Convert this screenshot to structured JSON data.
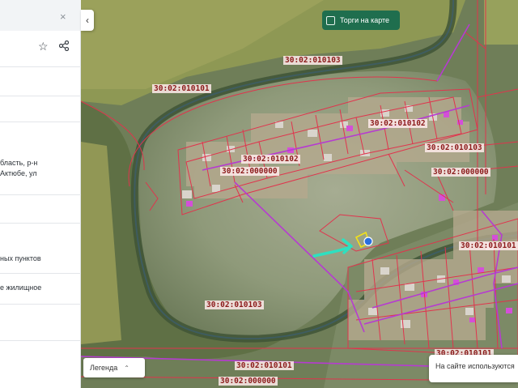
{
  "map": {
    "toggle_label": "Торги на карте",
    "cadastral_labels": [
      {
        "text": "30:02:010103"
      },
      {
        "text": "30:02:010101"
      },
      {
        "text": "30:02:010102"
      },
      {
        "text": "30:02:010102"
      },
      {
        "text": "30:02:000000"
      },
      {
        "text": "30:02:010103"
      },
      {
        "text": "30:02:000000"
      },
      {
        "text": "30:02:010101"
      },
      {
        "text": "30:02:010103"
      },
      {
        "text": "30:02:010101"
      },
      {
        "text": "30:02:000000"
      },
      {
        "text": "30:02:010101"
      }
    ]
  },
  "panel": {
    "close_icon": "×",
    "star_icon": "☆",
    "share_icon": "share-icon",
    "address_line1": "бласть, р-н",
    "address_line2": "Актюбе, ул",
    "category": "ных пунктов",
    "usage": "е жилищное"
  },
  "legend": {
    "label": "Легенда",
    "chevron": "⌃"
  },
  "cookie": {
    "text": "На сайте используются"
  },
  "colors": {
    "parcel": "#e0344d",
    "road": "#b63bd1",
    "pointer": "#2ee0c0",
    "target": "#2a6fe0",
    "boundary_yellow": "#f2e11a"
  }
}
